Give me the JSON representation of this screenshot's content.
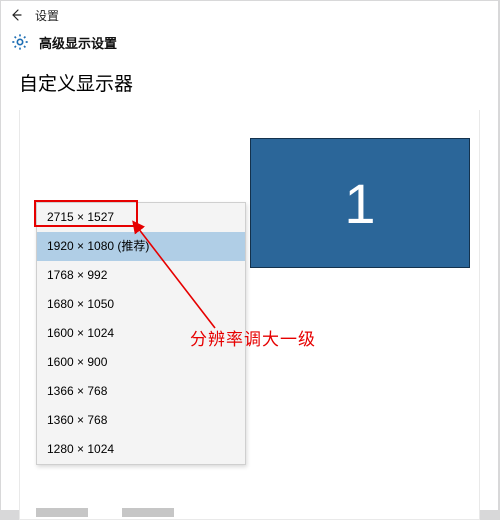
{
  "titlebar": {
    "label": "设置"
  },
  "section_header": {
    "label": "高级显示设置"
  },
  "content": {
    "heading": "自定义显示器"
  },
  "monitor": {
    "number": "1"
  },
  "resolution_options": [
    {
      "label": "2715 × 1527",
      "selected": false
    },
    {
      "label": "1920 × 1080 (推荐)",
      "selected": true
    },
    {
      "label": "1768 × 992",
      "selected": false
    },
    {
      "label": "1680 × 1050",
      "selected": false
    },
    {
      "label": "1600 × 1024",
      "selected": false
    },
    {
      "label": "1600 × 900",
      "selected": false
    },
    {
      "label": "1366 × 768",
      "selected": false
    },
    {
      "label": "1360 × 768",
      "selected": false
    },
    {
      "label": "1280 × 1024",
      "selected": false
    }
  ],
  "annotation": {
    "text": "分辨率调大一级",
    "highlight_color": "#e60000"
  }
}
